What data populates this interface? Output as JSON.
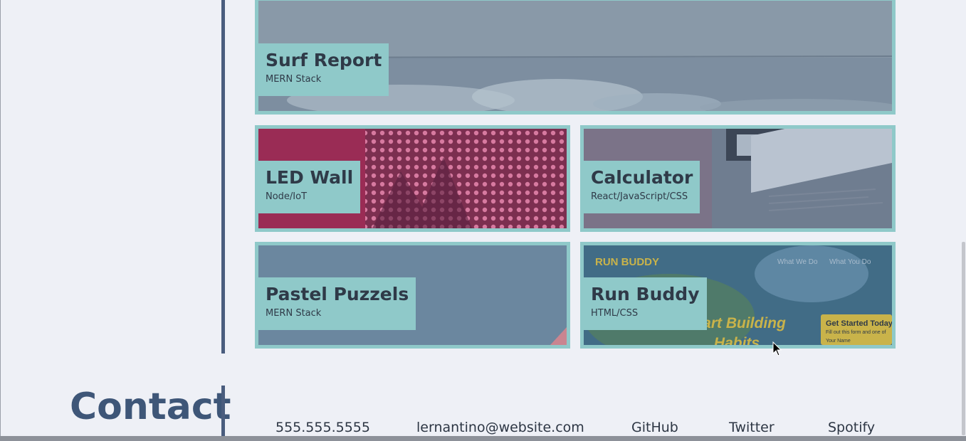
{
  "projects": [
    {
      "title": "Surf Report",
      "tech": "MERN Stack"
    },
    {
      "title": "LED Wall",
      "tech": "Node/IoT"
    },
    {
      "title": "Calculator",
      "tech": "React/JavaScript/CSS"
    },
    {
      "title": "Pastel Puzzels",
      "tech": "MERN Stack"
    },
    {
      "title": "Run Buddy",
      "tech": "HTML/CSS"
    }
  ],
  "run_buddy_preview": {
    "brand": "RUN BUDDY",
    "nav": [
      "What We Do",
      "What You Do"
    ],
    "hero": "Start Building Habits",
    "cta_title": "Get Started Today",
    "cta_text": "Fill out this form and one of",
    "cta_field": "Your Name"
  },
  "contact": {
    "heading": "Contact",
    "phone": "555.555.5555",
    "email": "lernantino@website.com",
    "github": "GitHub",
    "twitter": "Twitter",
    "spotify": "Spotify"
  },
  "colors": {
    "accent": "#8fc9c9",
    "heading": "#3e5678",
    "divider": "#4a5d7e",
    "background": "#eef0f6"
  }
}
